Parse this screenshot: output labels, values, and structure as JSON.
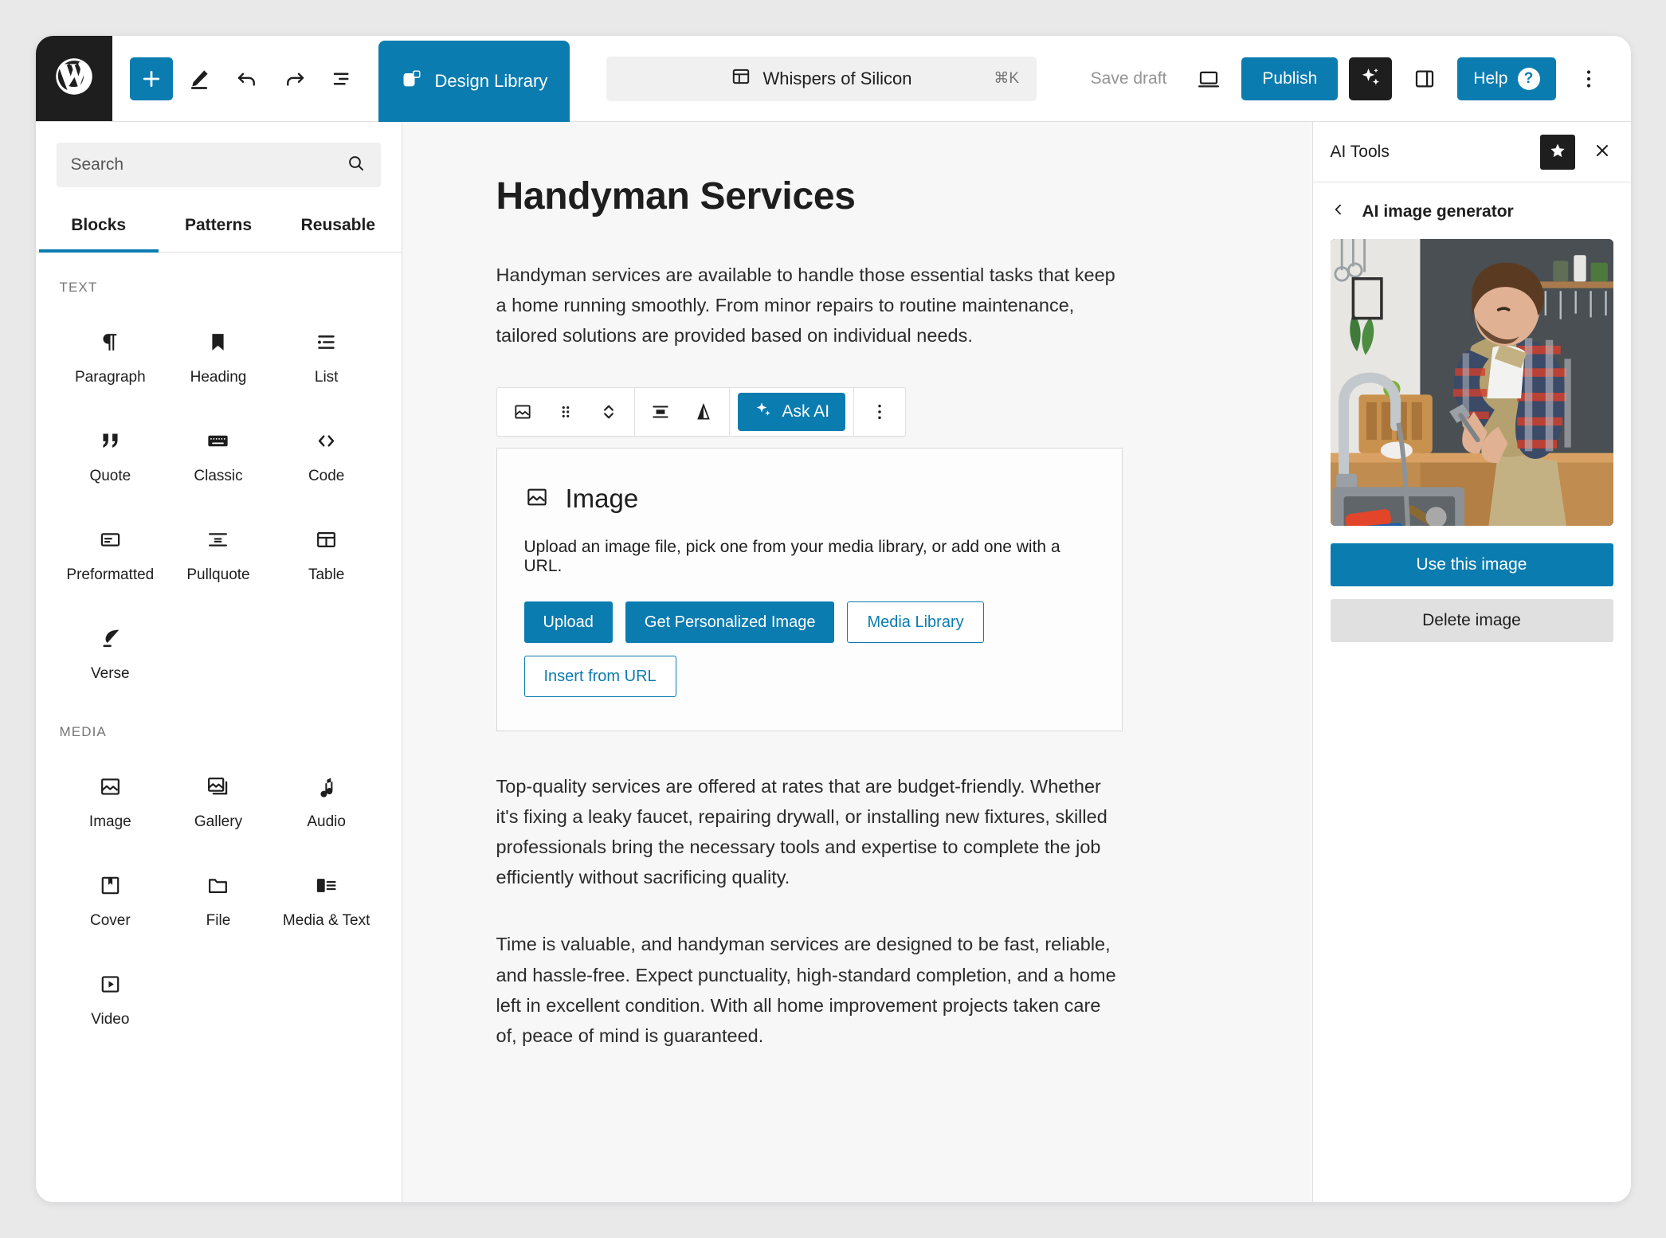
{
  "header": {
    "logo_icon": "wordpress-logo-icon",
    "tools": [
      {
        "name": "add-block-button",
        "icon": "plus-icon"
      },
      {
        "name": "edit-tool-button",
        "icon": "pencil-icon"
      },
      {
        "name": "undo-button",
        "icon": "undo-arrow-icon"
      },
      {
        "name": "redo-button",
        "icon": "redo-arrow-icon"
      },
      {
        "name": "document-overview-button",
        "icon": "list-view-icon"
      }
    ],
    "design_library_label": "Design Library",
    "document": {
      "title": "Whispers of Silicon",
      "shortcut": "⌘K",
      "icon": "layout-template-icon"
    },
    "save_draft_label": "Save draft",
    "preview_icon": "desktop-preview-icon",
    "publish_label": "Publish",
    "ai_icon": "sparkles-icon",
    "sidebar_toggle_icon": "sidebar-panel-icon",
    "help_label": "Help",
    "help_badge": "?",
    "more_icon": "kebab-menu-icon"
  },
  "sidebar": {
    "search": {
      "placeholder": "Search",
      "value": "",
      "icon": "search-icon"
    },
    "tabs": [
      {
        "label": "Blocks",
        "active": true
      },
      {
        "label": "Patterns",
        "active": false
      },
      {
        "label": "Reusable",
        "active": false
      }
    ],
    "groups": [
      {
        "label": "TEXT",
        "blocks": [
          {
            "label": "Paragraph",
            "icon": "paragraph-pilcrow-icon"
          },
          {
            "label": "Heading",
            "icon": "heading-bookmark-icon"
          },
          {
            "label": "List",
            "icon": "bullet-list-icon"
          },
          {
            "label": "Quote",
            "icon": "quote-marks-icon"
          },
          {
            "label": "Classic",
            "icon": "keyboard-icon"
          },
          {
            "label": "Code",
            "icon": "angle-brackets-icon"
          },
          {
            "label": "Preformatted",
            "icon": "preformatted-box-icon"
          },
          {
            "label": "Pullquote",
            "icon": "pullquote-icon"
          },
          {
            "label": "Table",
            "icon": "table-grid-icon"
          },
          {
            "label": "Verse",
            "icon": "feather-quill-icon"
          }
        ]
      },
      {
        "label": "MEDIA",
        "blocks": [
          {
            "label": "Image",
            "icon": "image-icon"
          },
          {
            "label": "Gallery",
            "icon": "gallery-stack-icon"
          },
          {
            "label": "Audio",
            "icon": "music-note-icon"
          },
          {
            "label": "Cover",
            "icon": "cover-bookmark-icon"
          },
          {
            "label": "File",
            "icon": "folder-icon"
          },
          {
            "label": "Media & Text",
            "icon": "media-and-text-icon"
          },
          {
            "label": "Video",
            "icon": "video-play-icon"
          }
        ]
      }
    ]
  },
  "editor": {
    "post_title": "Handyman Services",
    "paragraph_1": "Handyman services are available to handle those essential tasks that keep a home running smoothly. From minor repairs to routine maintenance, tailored solutions are provided based on individual needs.",
    "paragraph_2": "Top-quality services are offered at rates that are budget-friendly. Whether it's fixing a leaky faucet, repairing drywall, or installing new fixtures, skilled professionals bring the necessary tools and expertise to complete the job efficiently without sacrificing quality.",
    "paragraph_3": "Time is valuable, and handyman services are designed to be fast, reliable, and hassle-free. Expect punctuality, high-standard completion, and a home left in excellent condition. With all home improvement projects taken care of, peace of mind is guaranteed.",
    "block_toolbar": {
      "block_type_icon": "image-icon",
      "drag_icon": "drag-handle-dots-icon",
      "move_icon": "move-up-down-chevrons-icon",
      "align_icon": "align-center-icon",
      "filter_icon": "duotone-filter-icon",
      "ask_ai_label": "Ask AI",
      "ask_ai_icon": "sparkles-icon",
      "more_icon": "kebab-menu-icon"
    },
    "image_block": {
      "icon": "image-icon",
      "title": "Image",
      "description": "Upload an image file, pick one from your media library, or add one with a URL.",
      "buttons": [
        {
          "label": "Upload",
          "style": "fill"
        },
        {
          "label": "Get Personalized Image",
          "style": "fill"
        },
        {
          "label": "Media Library",
          "style": "outline"
        },
        {
          "label": "Insert from URL",
          "style": "outline"
        }
      ]
    }
  },
  "ai_panel": {
    "title": "AI Tools",
    "star_icon": "star-icon",
    "close_icon": "close-x-icon",
    "back_icon": "chevron-left-icon",
    "section_label": "AI image generator",
    "generated_image_alt": "plumber repairing a kitchen sink faucet",
    "use_image_label": "Use this image",
    "delete_image_label": "Delete image"
  },
  "colors": {
    "accent": "#0b7cb0",
    "dark": "#1e1e1e",
    "canvas_bg": "#f7f7f7",
    "muted_text": "#757575",
    "panel_border": "#e0e0e0"
  }
}
